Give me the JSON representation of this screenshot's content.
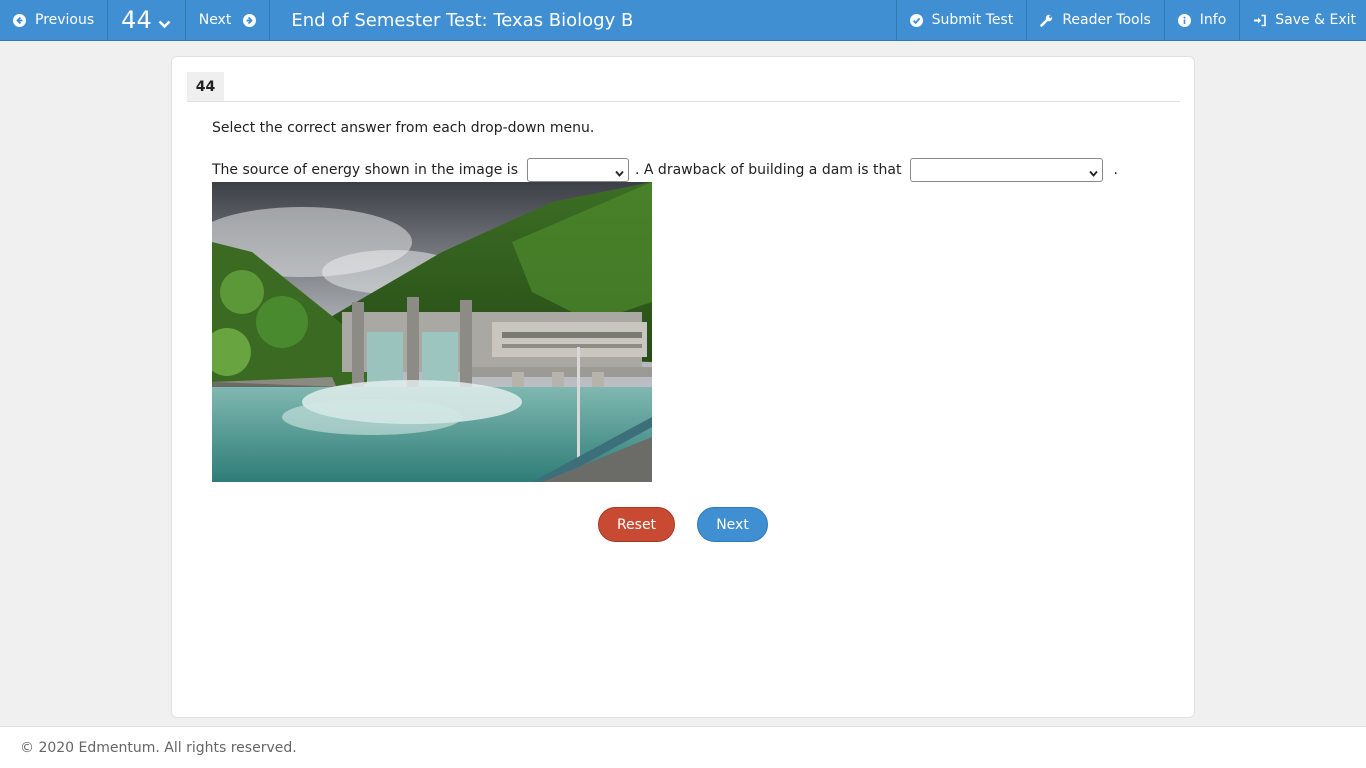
{
  "toolbar": {
    "previous_label": "Previous",
    "question_number": "44",
    "next_label": "Next",
    "title": "End of Semester Test: Texas Biology B",
    "submit_label": "Submit Test",
    "reader_tools_label": "Reader Tools",
    "info_label": "Info",
    "save_exit_label": "Save & Exit"
  },
  "question": {
    "badge": "44",
    "instruction": "Select the correct answer from each drop-down menu.",
    "text_part1": "The source of energy shown in the image is",
    "text_part2": ". A drawback of building a dam is that",
    "text_end": ".",
    "dropdown1_value": "",
    "dropdown2_value": ""
  },
  "buttons": {
    "reset_label": "Reset",
    "next_label": "Next"
  },
  "footer": {
    "copyright": "© 2020 Edmentum. All rights reserved."
  },
  "colors": {
    "topbar": "#3f8fd2",
    "reset": "#c94a33",
    "next": "#3f8fd2"
  }
}
